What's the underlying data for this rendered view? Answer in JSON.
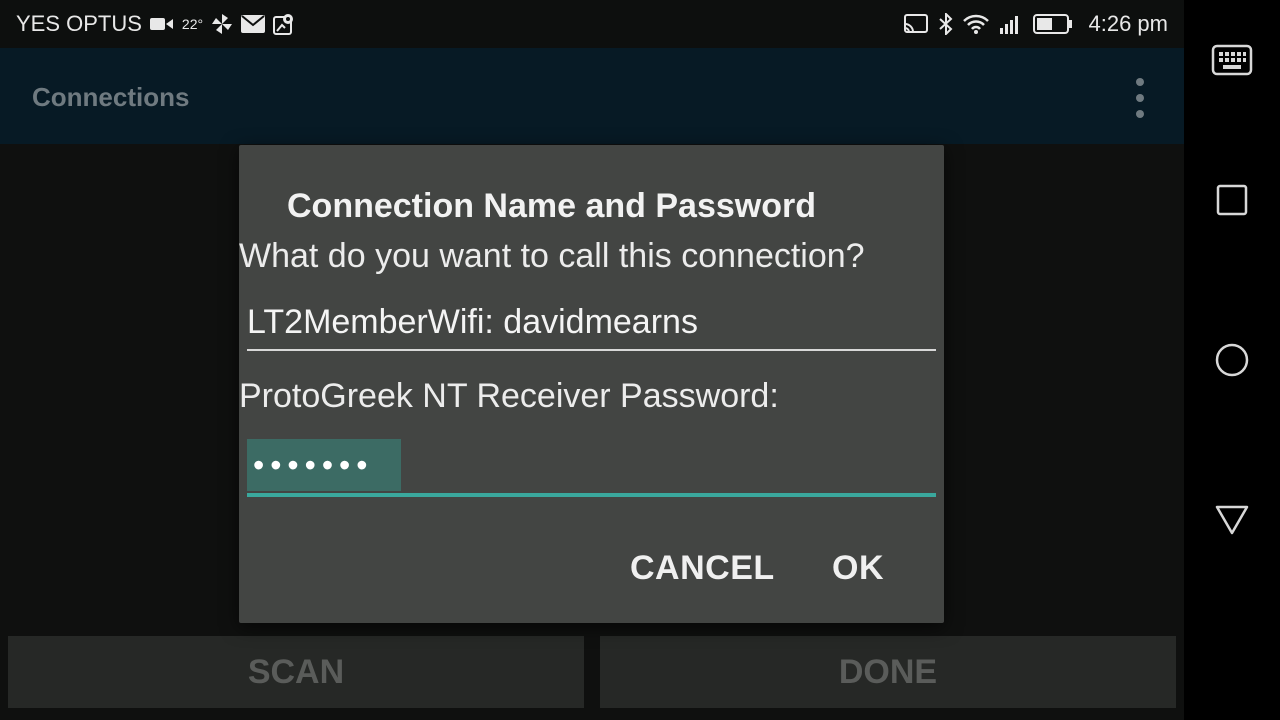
{
  "status_bar": {
    "carrier": "YES OPTUS",
    "temperature": "22°",
    "time": "4:26 pm",
    "battery_level": 0.55,
    "left_icons": [
      "video-icon",
      "pinwheel-icon",
      "mail-icon",
      "map-icon"
    ],
    "right_icons": [
      "cast-icon",
      "bluetooth-icon",
      "wifi-icon",
      "signal-icon",
      "battery-icon"
    ]
  },
  "app_bar": {
    "title": "Connections",
    "menu_icon": "overflow-menu-icon"
  },
  "dialog": {
    "title": "Connection Name and Password",
    "name_prompt": "What do you want to call this connection?",
    "name_value": "LT2MemberWifi: davidmearns",
    "password_label": "ProtoGreek NT Receiver Password:",
    "password_value": "•••••••",
    "cancel_label": "CANCEL",
    "ok_label": "OK"
  },
  "bottom_buttons": {
    "scan_label": "SCAN",
    "done_label": "DONE"
  },
  "nav_bar": {
    "items": [
      "keyboard-icon",
      "recents-icon",
      "home-icon",
      "back-icon"
    ]
  },
  "colors": {
    "app_bar": "#071a25",
    "dialog": "#434543",
    "accent": "#3aa89d",
    "selection": "#3c6b64"
  }
}
